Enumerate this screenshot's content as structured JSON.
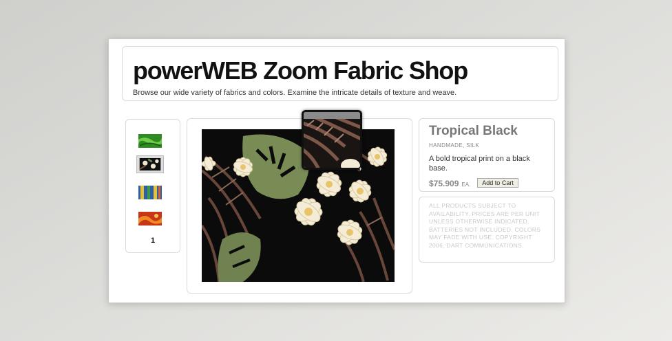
{
  "shop": {
    "title": "powerWEB Zoom Fabric Shop",
    "tagline": "Browse our wide variety of fabrics and colors. Examine the intricate details of texture and weave."
  },
  "thumbnails": {
    "items": [
      {
        "name": "green-fabric",
        "color": "#3a9a2a"
      },
      {
        "name": "tropical-black-fabric",
        "color": "#1a1a1a"
      },
      {
        "name": "blue-yellow-fabric",
        "color": "#2e5fa8"
      },
      {
        "name": "red-orange-fabric",
        "color": "#c8361a"
      }
    ],
    "selected_index": 1,
    "page": "1"
  },
  "product": {
    "name": "Tropical Black",
    "tags": "HANDMADE, SILK",
    "description": "A bold tropical print on a black base.",
    "price": "$75.909",
    "unit": "EA.",
    "add_to_cart_label": "Add to Cart"
  },
  "notice": {
    "text": "ALL PRODUCTS SUBJECT TO AVAILABILITY. PRICES ARE PER UNIT UNLESS OTHERWISE INDICATED. BATTERIES NOT INCLUDED. COLORS MAY FADE WITH USE. COPYRIGHT 2006, DART COMMUNICATIONS."
  },
  "icons": {
    "zoom_lens": "zoom-lens-icon",
    "cursor": "crosshair-cursor-icon"
  },
  "colors": {
    "background": "#d8d8d5",
    "panel": "#ffffff",
    "border": "#dadada",
    "fabric_base": "#0b0b0b",
    "flower": "#f4ecd6",
    "leaf_green": "#7a8c56",
    "frond_brown": "#6e4a3c"
  }
}
